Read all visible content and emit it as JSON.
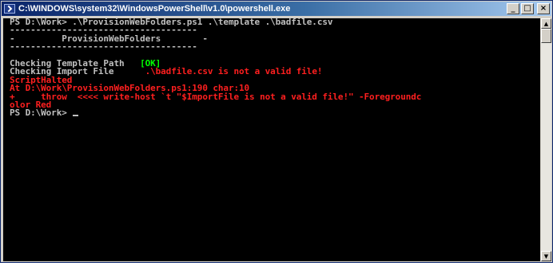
{
  "window": {
    "title": "C:\\WINDOWS\\system32\\WindowsPowerShell\\v1.0\\powershell.exe",
    "minimize_glyph": "_",
    "maximize_glyph": "□",
    "close_glyph": "×"
  },
  "console": {
    "line01": "PS D:\\Work> .\\ProvisionWebFolders.ps1 .\\template .\\badfile.csv",
    "line02": "------------------------------------",
    "line03": "-         ProvisionWebFolders        -",
    "line04": "------------------------------------",
    "line06a": "Checking Template Path   ",
    "line06b": "[OK]",
    "line07a": "Checking Import File      ",
    "line07b": ".\\badfile.csv is not a valid file!",
    "line08": "ScriptHalted",
    "line09": "At D:\\Work\\ProvisionWebFolders.ps1:190 char:10",
    "line10": "+     throw  <<<< write-host `t \"$ImportFile is not a valid file!\" -Foregroundc",
    "line11": "olor Red",
    "line12": "PS D:\\Work> "
  },
  "scrollbar": {
    "up_glyph": "▲",
    "down_glyph": "▼"
  },
  "colors": {
    "background": "#000000",
    "text": "#c0c0c0",
    "error": "#ff1f1f",
    "ok": "#00ff00"
  }
}
